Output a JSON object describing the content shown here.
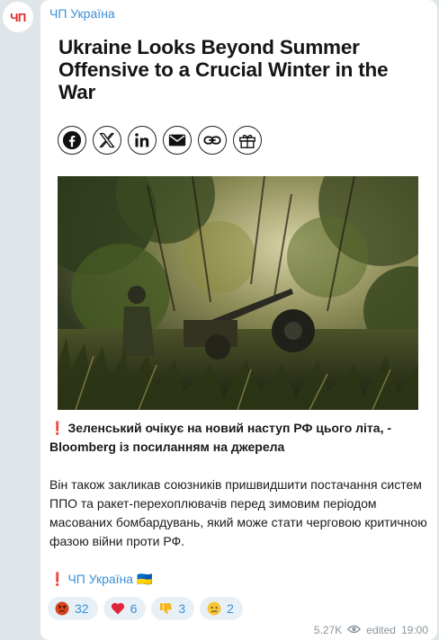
{
  "channel": {
    "name": "ЧП Україна",
    "avatar_text": "ЧП"
  },
  "article": {
    "title": "Ukraine Looks Beyond Summer Offensive to a Crucial Winter in the War",
    "share_icons": [
      "facebook-icon",
      "x-icon",
      "linkedin-icon",
      "email-icon",
      "link-icon",
      "gift-icon"
    ]
  },
  "post": {
    "headline_mark": "❗",
    "headline": "Зеленський очікує на новий наступ РФ цього літа, - Bloomberg із посиланням на джерела",
    "body": "Він також закликав союзників пришвидшити постачання систем ППО та ракет-перехоплювачів перед зимовим періодом масованих бомбардувань, який може стати черговою критичною фазою війни проти РФ.",
    "signature_mark": "❗",
    "signature": "ЧП Україна",
    "signature_flag": "🇺🇦"
  },
  "reactions": [
    {
      "icon": "angry-face-icon",
      "count": "32"
    },
    {
      "icon": "heart-icon",
      "count": "6"
    },
    {
      "icon": "thumbs-down-icon",
      "count": "3"
    },
    {
      "icon": "crying-face-icon",
      "count": "2"
    }
  ],
  "meta": {
    "views": "5.27K",
    "edited": "edited",
    "time": "19:00"
  },
  "colors": {
    "link": "#3a8fd6",
    "background": "#dfe6ea",
    "reaction_bg": "#e8f0f7",
    "alert": "#e02424"
  }
}
